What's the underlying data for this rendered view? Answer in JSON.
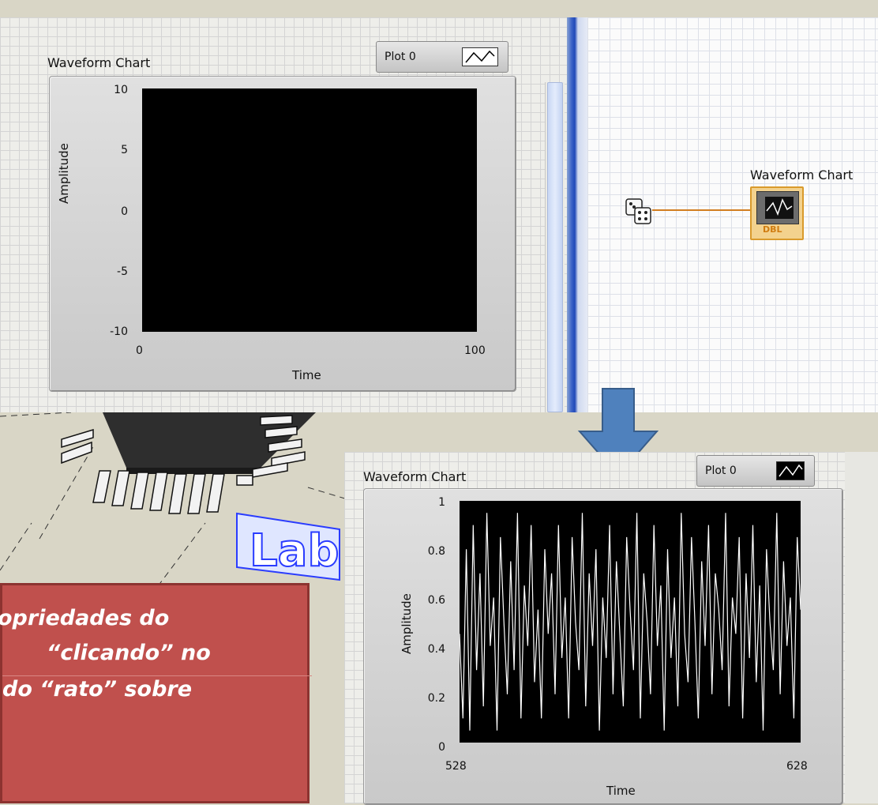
{
  "front_panel_chart": {
    "label": "Waveform Chart",
    "legend_label": "Plot 0",
    "y_axis_label": "Amplitude",
    "x_axis_label": "Time",
    "y_ticks": [
      "10",
      "5",
      "0",
      "-5",
      "-10"
    ],
    "x_ticks": [
      "0",
      "100"
    ]
  },
  "block_diagram": {
    "chart_terminal_label": "Waveform Chart",
    "terminal_type": "DBL",
    "random_node_icon": "dice-icon"
  },
  "arrow": {
    "color": "#4f81bd"
  },
  "result_chart": {
    "label": "Waveform Chart",
    "legend_label": "Plot 0",
    "y_axis_label": "Amplitude",
    "x_axis_label": "Time",
    "y_ticks": [
      "1",
      "0.8",
      "0.6",
      "0.4",
      "0.2",
      "0"
    ],
    "x_ticks": [
      "528",
      "628"
    ]
  },
  "callout": {
    "line1": "opriedades do",
    "line2": "“clicando” no",
    "line3": "do “rato” sobre",
    "color": "#c0504d"
  },
  "logo_3d_text": "Lab",
  "chart_data": {
    "type": "line",
    "x_start": 528,
    "x_end": 628,
    "xlim": [
      528,
      628
    ],
    "ylim": [
      0,
      1
    ],
    "xlabel": "Time",
    "ylabel": "Amplitude",
    "series": [
      {
        "values": [
          0.45,
          0.1,
          0.8,
          0.05,
          0.9,
          0.3,
          0.7,
          0.15,
          0.95,
          0.4,
          0.6,
          0.05,
          0.85,
          0.5,
          0.2,
          0.75,
          0.3,
          0.95,
          0.1,
          0.65,
          0.4,
          0.9,
          0.25,
          0.55,
          0.1,
          0.8,
          0.45,
          0.7,
          0.2,
          0.9,
          0.35,
          0.6,
          0.1,
          0.85,
          0.5,
          0.3,
          0.95,
          0.15,
          0.7,
          0.4,
          0.8,
          0.05,
          0.6,
          0.35,
          0.9,
          0.2,
          0.75,
          0.45,
          0.15,
          0.85,
          0.55,
          0.3,
          0.95,
          0.1,
          0.7,
          0.5,
          0.2,
          0.9,
          0.4,
          0.65,
          0.05,
          0.8,
          0.35,
          0.6,
          0.15,
          0.95,
          0.45,
          0.25,
          0.85,
          0.5,
          0.1,
          0.75,
          0.4,
          0.9,
          0.2,
          0.7,
          0.55,
          0.3,
          0.95,
          0.15,
          0.6,
          0.45,
          0.85,
          0.1,
          0.7,
          0.35,
          0.9,
          0.25,
          0.65,
          0.05,
          0.8,
          0.5,
          0.3,
          0.95,
          0.2,
          0.75,
          0.4,
          0.6,
          0.1,
          0.85,
          0.55
        ]
      }
    ]
  }
}
